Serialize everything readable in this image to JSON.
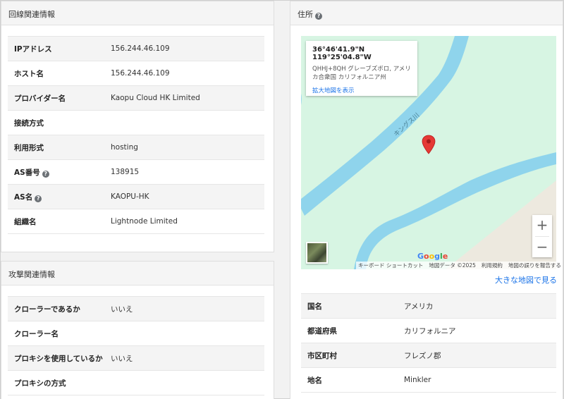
{
  "line_info": {
    "title": "回線関連情報",
    "rows": [
      {
        "key": "IPアドレス",
        "value": "156.244.46.109"
      },
      {
        "key": "ホスト名",
        "value": "156.244.46.109"
      },
      {
        "key": "プロバイダー名",
        "value": "Kaopu Cloud HK Limited"
      },
      {
        "key": "接続方式",
        "value": ""
      },
      {
        "key": "利用形式",
        "value": "hosting"
      },
      {
        "key": "AS番号",
        "value": "138915"
      },
      {
        "key": "AS名",
        "value": "KAOPU-HK"
      },
      {
        "key": "組織名",
        "value": "Lightnode Limited"
      }
    ]
  },
  "attack_info": {
    "title": "攻撃関連情報",
    "rows": [
      {
        "key": "クローラーであるか",
        "value": "いいえ"
      },
      {
        "key": "クローラー名",
        "value": ""
      },
      {
        "key": "プロキシを使用しているか",
        "value": "いいえ"
      },
      {
        "key": "プロキシの方式",
        "value": ""
      }
    ]
  },
  "address": {
    "title": "住所",
    "help_glyph": "?",
    "map": {
      "coords": "36°46'41.9\"N 119°25'04.8\"W",
      "plus_code": "QHHJ+8QH グレーブズボロ, アメリカ合衆国 カリフォルニア州",
      "enlarge_link": "拡大地図を表示",
      "river_label": "キングス川",
      "google": "Google",
      "footer": [
        "キーボード ショートカット",
        "地図データ ©2025",
        "利用規約",
        "地図の誤りを報告する"
      ],
      "zoom_in": "+",
      "zoom_out": "−",
      "colors": {
        "land": "#d7f5e3",
        "water": "#8fd4ec",
        "pin": "#e53935"
      }
    },
    "bigmap_link": "大きな地図で見る",
    "rows": [
      {
        "key": "国名",
        "value": "アメリカ"
      },
      {
        "key": "都道府県",
        "value": "カリフォルニア"
      },
      {
        "key": "市区町村",
        "value": "フレズノ郡"
      },
      {
        "key": "地名",
        "value": "Minkler"
      }
    ]
  }
}
